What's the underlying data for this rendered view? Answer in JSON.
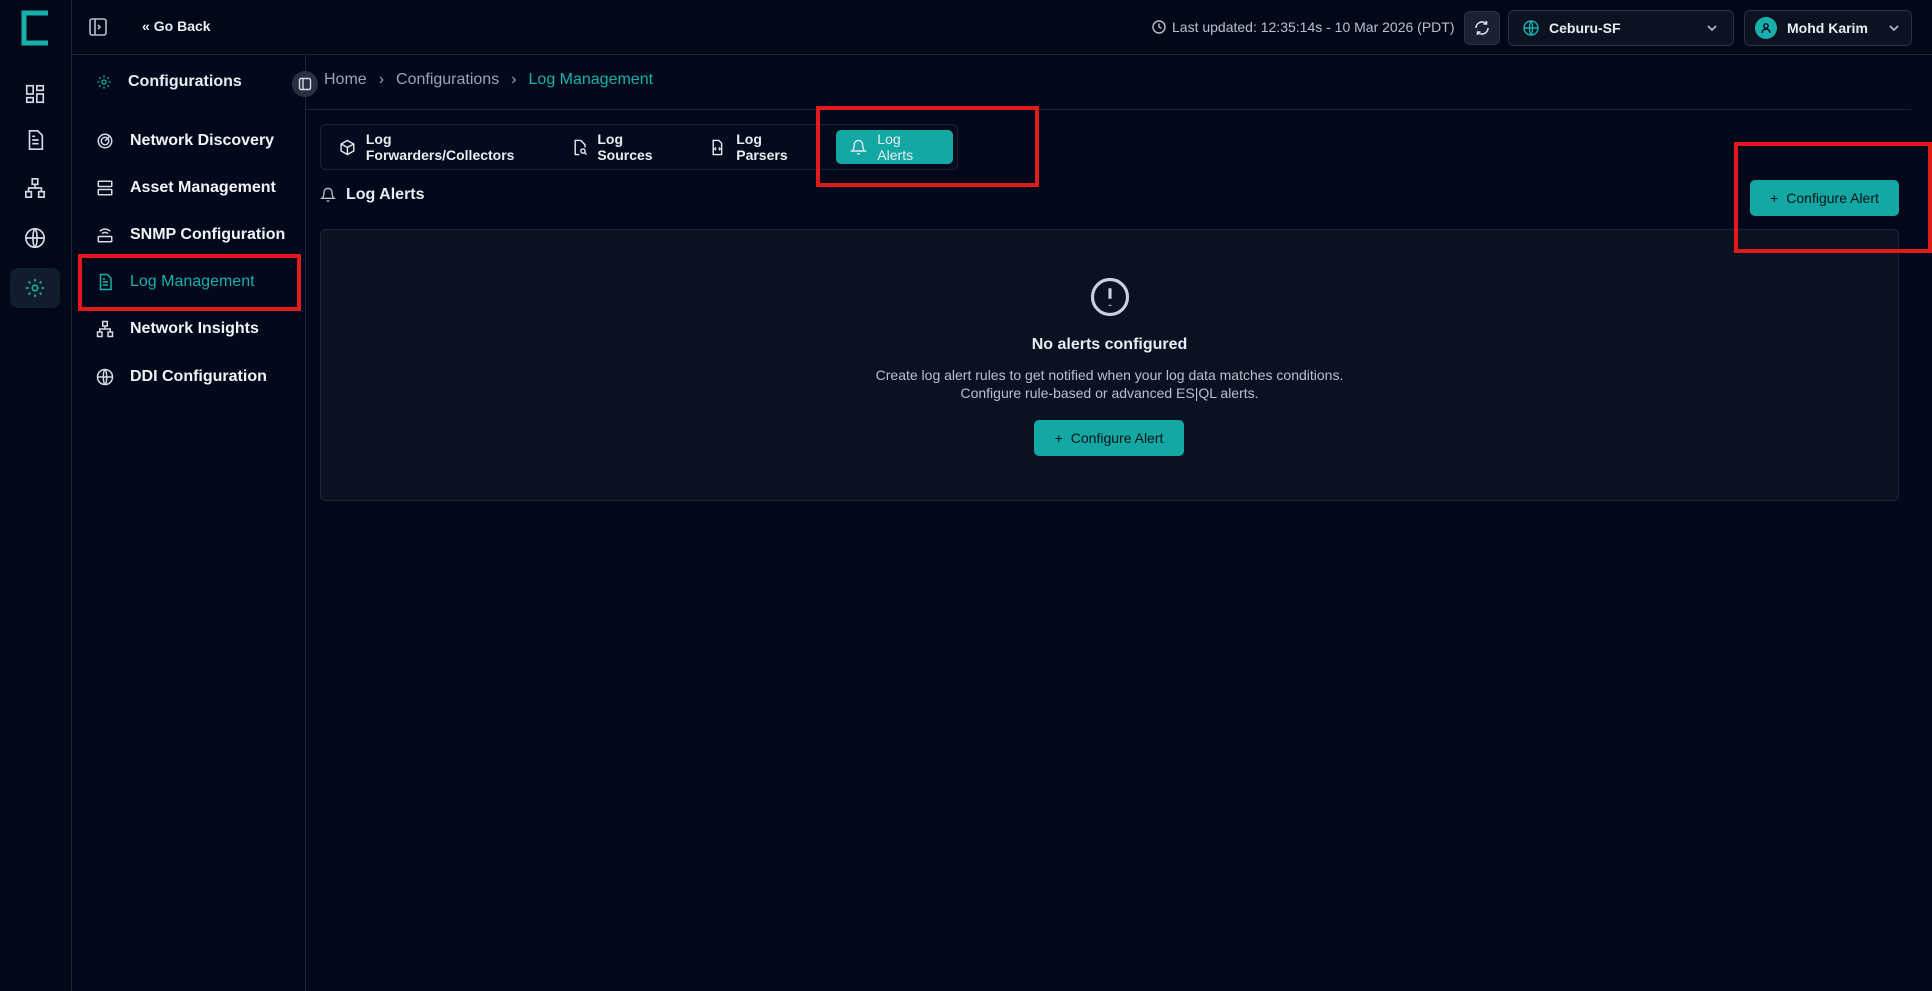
{
  "topbar": {
    "go_back": "Go Back",
    "last_updated": "Last updated: 12:35:14s - 10 Mar 2026 (PDT)",
    "site": "Ceburu-SF",
    "user": "Mohd Karim"
  },
  "subnav": {
    "title": "Configurations",
    "items": [
      {
        "label": "Network Discovery",
        "icon": "radar-icon"
      },
      {
        "label": "Asset Management",
        "icon": "server-icon"
      },
      {
        "label": "SNMP Configuration",
        "icon": "router-icon"
      },
      {
        "label": "Log Management",
        "icon": "file-text-icon",
        "active": true
      },
      {
        "label": "Network Insights",
        "icon": "network-icon"
      },
      {
        "label": "DDI Configuration",
        "icon": "globe-icon"
      }
    ]
  },
  "breadcrumb": [
    "Home",
    "Configurations",
    "Log Management"
  ],
  "tabs": [
    {
      "label": "Log Forwarders/Collectors",
      "icon": "box-icon"
    },
    {
      "label": "Log Sources",
      "icon": "file-search-icon"
    },
    {
      "label": "Log Parsers",
      "icon": "file-code-icon"
    },
    {
      "label": "Log Alerts",
      "icon": "bell-icon",
      "active": true
    }
  ],
  "section": {
    "title": "Log Alerts",
    "configure_button": "Configure Alert"
  },
  "empty_state": {
    "title": "No alerts configured",
    "line1": "Create log alert rules to get notified when your log data matches conditions.",
    "line2": "Configure rule-based or advanced ES|QL alerts.",
    "button": "Configure Alert"
  },
  "colors": {
    "accent": "#13a8a4",
    "background": "#03091a",
    "highlight": "#e01b1b"
  }
}
